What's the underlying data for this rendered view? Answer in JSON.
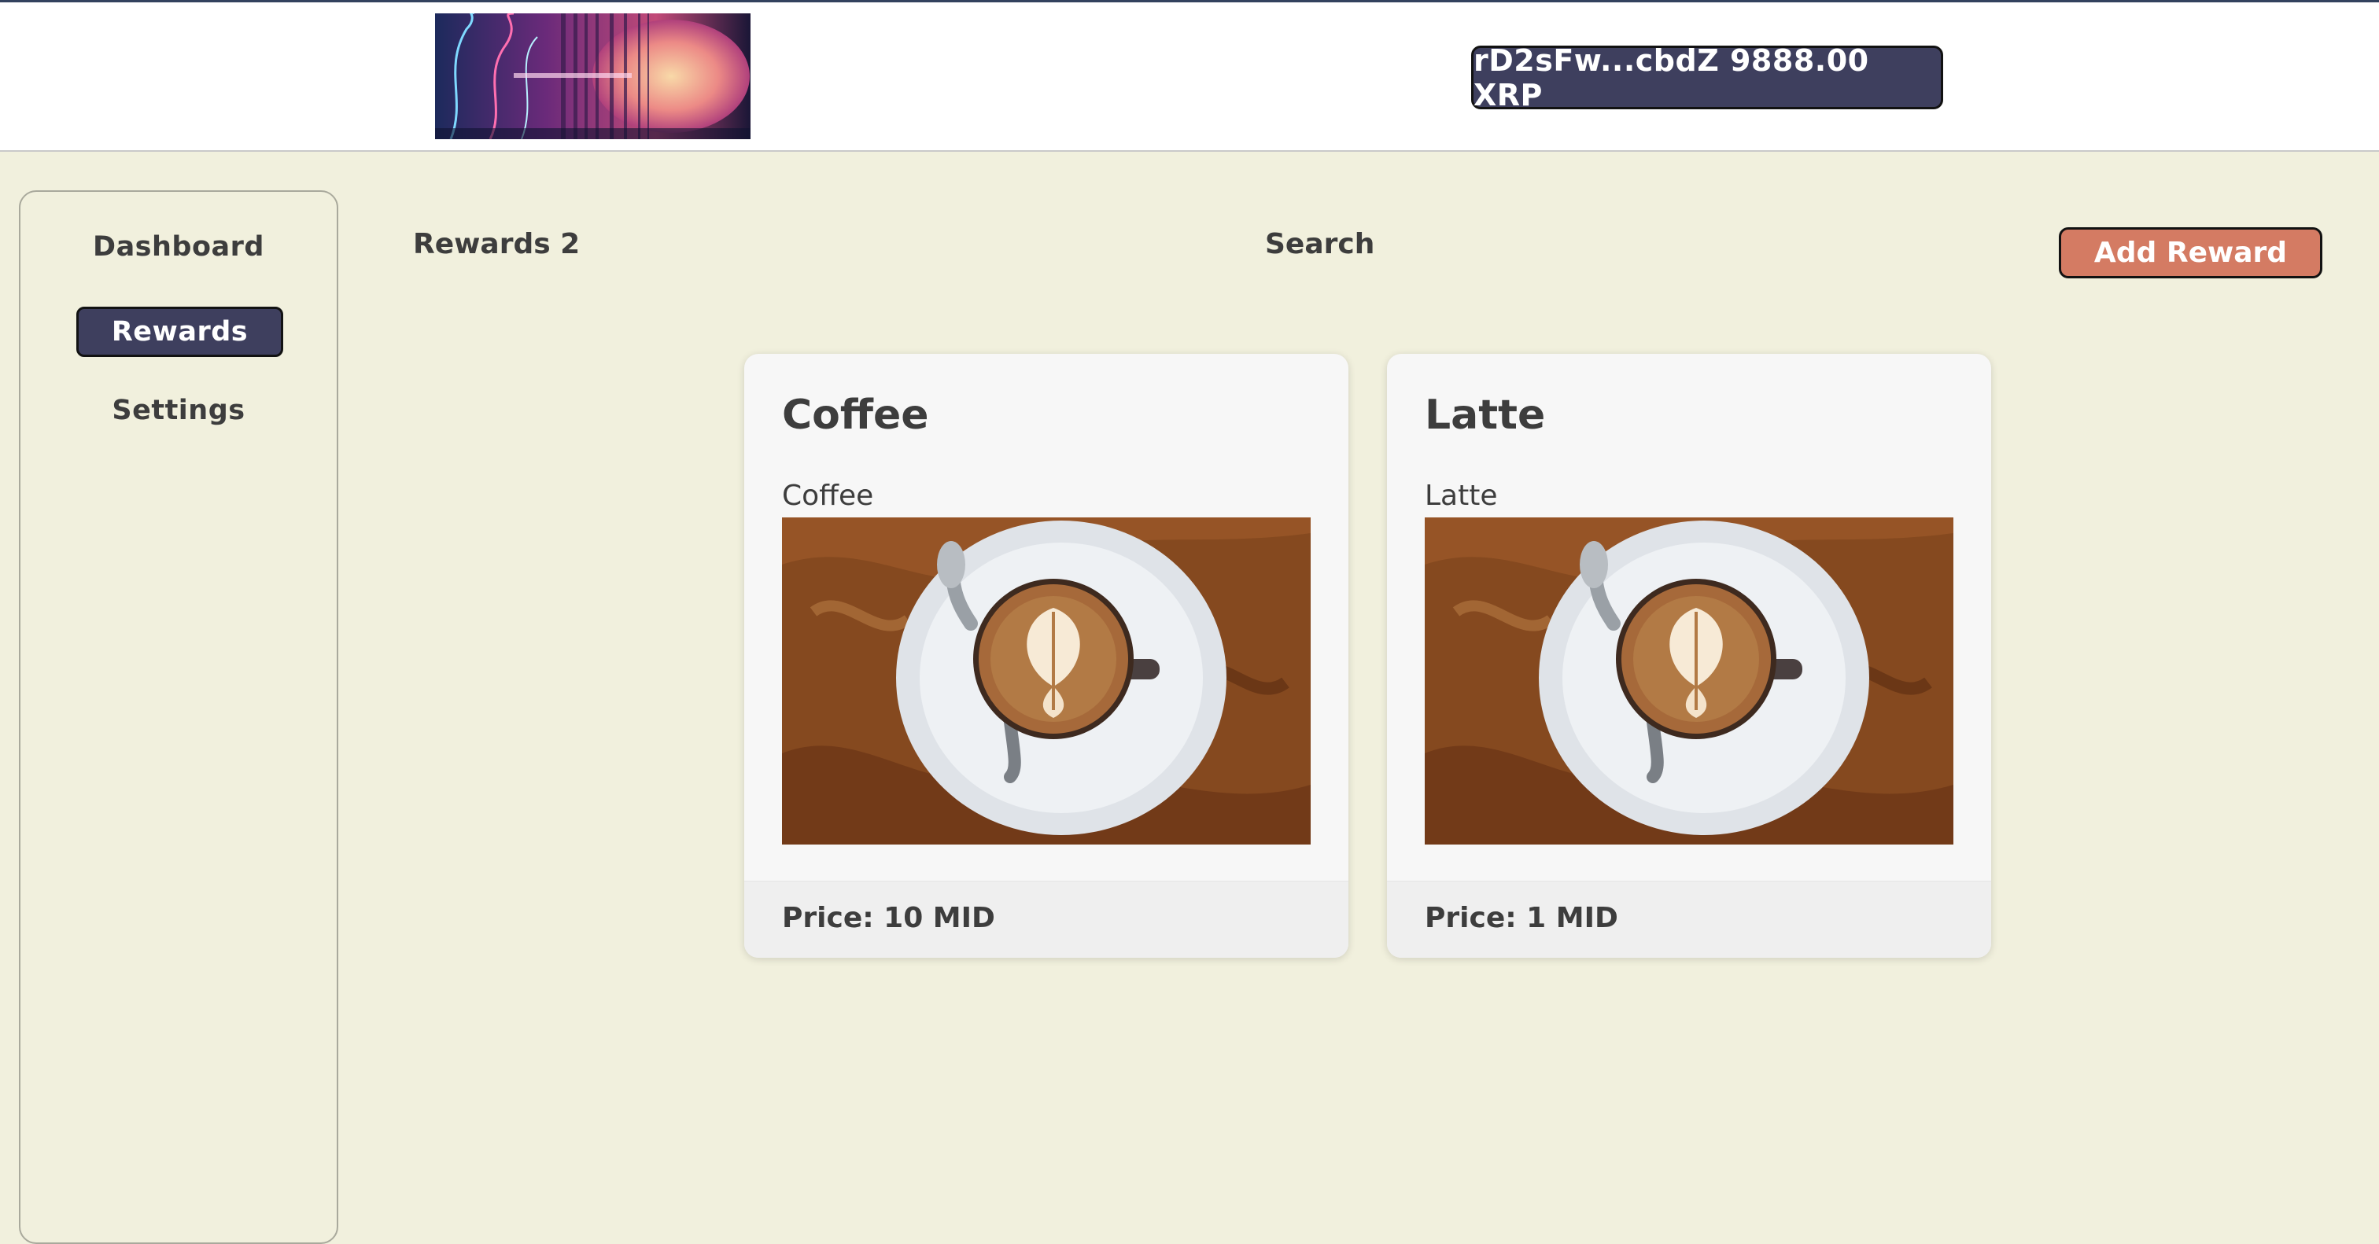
{
  "header": {
    "logo_icon": "synthwave-logo-image",
    "wallet_label": "rD2sFw...cbdZ 9888.00 XRP"
  },
  "sidebar": {
    "items": [
      {
        "label": "Dashboard",
        "active": false
      },
      {
        "label": "Rewards",
        "active": true
      },
      {
        "label": "Settings",
        "active": false
      }
    ]
  },
  "main": {
    "title": "Rewards 2",
    "search_label": "Search",
    "add_button_label": "Add Reward",
    "cards": [
      {
        "title": "Coffee",
        "subtitle": "Coffee",
        "image_icon": "latte-art-photo",
        "price": "Price: 10 MID"
      },
      {
        "title": "Latte",
        "subtitle": "Latte",
        "image_icon": "latte-art-photo",
        "price": "Price: 1 MID"
      }
    ]
  },
  "colors": {
    "page_bg": "#f1f0dd",
    "accent": "#3e3f5e",
    "add_button": "#d47b63",
    "card_bg": "#f7f7f7"
  }
}
